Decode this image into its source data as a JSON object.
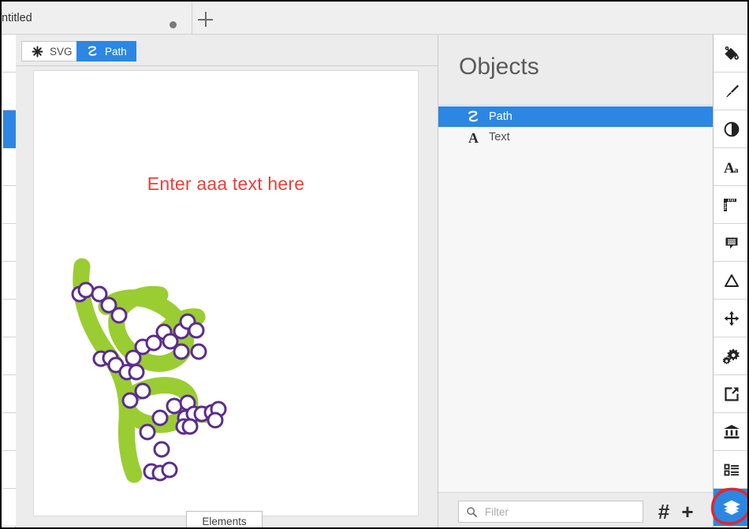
{
  "window": {
    "tab": {
      "title": "ntitled",
      "dot_icon": "record-dot-icon",
      "new_tab_icon": "plus-icon"
    }
  },
  "left_toolbar": {
    "buttons": [
      {
        "name": "tool-1",
        "selected": false
      },
      {
        "name": "tool-2",
        "selected": false
      },
      {
        "name": "tool-3",
        "selected": true
      },
      {
        "name": "tool-4",
        "selected": false
      },
      {
        "name": "tool-5",
        "selected": false
      },
      {
        "name": "tool-6",
        "selected": false
      },
      {
        "name": "tool-7",
        "selected": false
      },
      {
        "name": "tool-8",
        "selected": false
      },
      {
        "name": "tool-9",
        "selected": false
      },
      {
        "name": "tool-10",
        "selected": false
      },
      {
        "name": "tool-11",
        "selected": false
      },
      {
        "name": "tool-12",
        "selected": false
      },
      {
        "name": "tool-13",
        "selected": false
      }
    ]
  },
  "editor": {
    "tabs": [
      {
        "label": "SVG",
        "icon": "asterisk-icon",
        "active": false
      },
      {
        "label": "Path",
        "icon": "path-curve-icon",
        "active": true
      }
    ],
    "canvas": {
      "text": "Enter aaa text here",
      "text_color": "#e8403a",
      "path_fill": "#9acd32",
      "path_stroke": "#8fb832",
      "node_fill": "#ffffff",
      "node_stroke": "#5b2d8e",
      "background": "#ffffff"
    },
    "bottom_tab": {
      "label": "Elements"
    }
  },
  "objects_panel": {
    "title": "Objects",
    "items": [
      {
        "label": "Path",
        "icon": "path-curve-icon",
        "selected": true
      },
      {
        "label": "Text",
        "icon": "text-a-icon",
        "selected": false
      }
    ],
    "footer": {
      "filter_placeholder": "Filter",
      "filter_value": "",
      "search_icon": "search-icon",
      "hash_label": "#",
      "plus_label": "+"
    }
  },
  "right_rail": {
    "accent_color": "#2b87e3",
    "annotation_color": "#e8232a",
    "buttons": [
      {
        "name": "fill-bucket-icon",
        "active": false,
        "annotated": false
      },
      {
        "name": "paint-brush-icon",
        "active": false,
        "annotated": false
      },
      {
        "name": "contrast-circle-icon",
        "active": false,
        "annotated": false
      },
      {
        "name": "font-size-icon",
        "active": false,
        "annotated": false
      },
      {
        "name": "ruler-icon",
        "active": false,
        "annotated": false
      },
      {
        "name": "comment-bubble-icon",
        "active": false,
        "annotated": false
      },
      {
        "name": "triangle-shape-icon",
        "active": false,
        "annotated": false
      },
      {
        "name": "move-arrows-icon",
        "active": false,
        "annotated": false
      },
      {
        "name": "gears-icon",
        "active": false,
        "annotated": false
      },
      {
        "name": "export-arrow-icon",
        "active": false,
        "annotated": false
      },
      {
        "name": "bank-columns-icon",
        "active": false,
        "annotated": false
      },
      {
        "name": "list-view-icon",
        "active": false,
        "annotated": false
      },
      {
        "name": "layers-icon",
        "active": true,
        "annotated": true
      }
    ]
  }
}
